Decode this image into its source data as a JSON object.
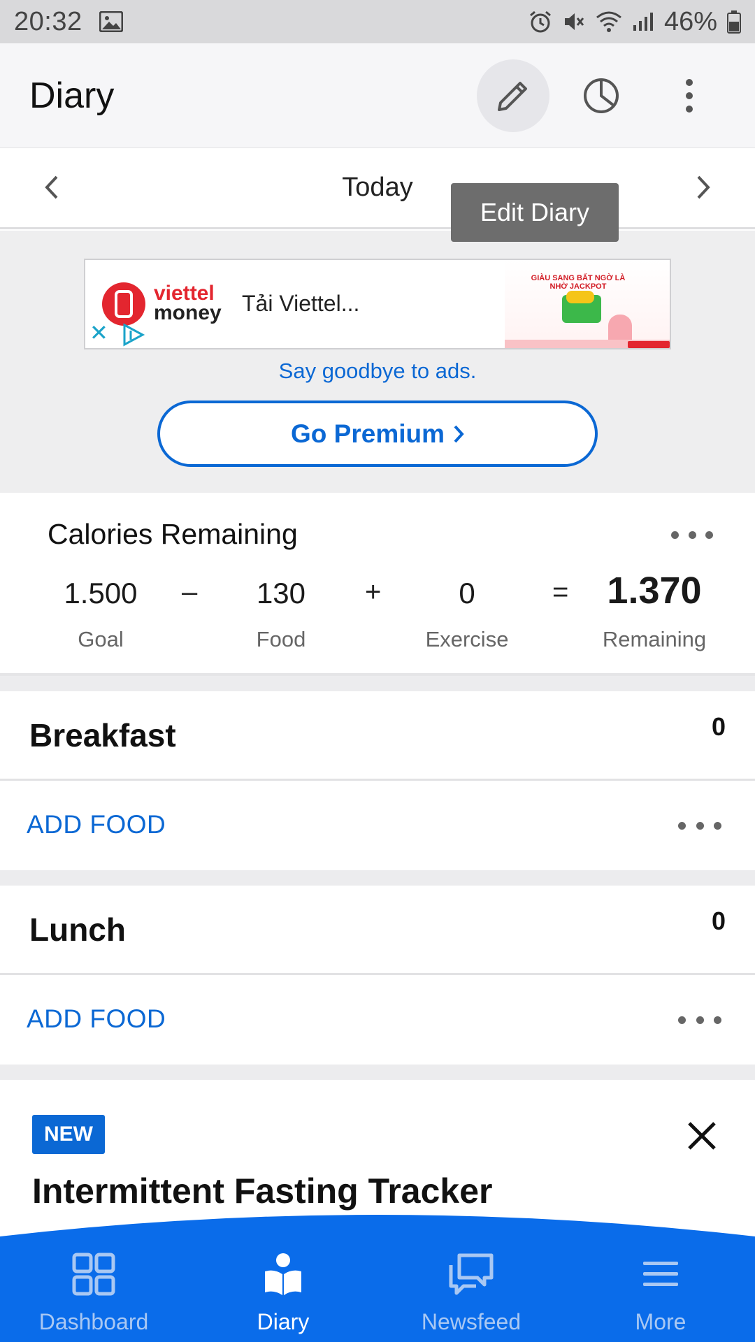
{
  "status_bar": {
    "time": "20:32",
    "battery": "46%"
  },
  "app_bar": {
    "title": "Diary",
    "icons": [
      "pencil-icon",
      "pie-chart-icon",
      "overflow-menu-icon"
    ]
  },
  "tooltip": {
    "text": "Edit Diary"
  },
  "date_nav": {
    "label": "Today"
  },
  "ad": {
    "brand_line1": "viettel",
    "brand_line2": "money",
    "text": "Tải Viettel...",
    "image_caption": "GIÀU SANG BẤT NGỜ LÀ NHỜ JACKPOT",
    "goodbye_text": "Say goodbye to ads.",
    "premium_label": "Go Premium",
    "colors": {
      "brand_red": "#e3262f"
    }
  },
  "calories": {
    "title": "Calories Remaining",
    "goal": {
      "value": "1.500",
      "label": "Goal"
    },
    "op_minus": "–",
    "food": {
      "value": "130",
      "label": "Food"
    },
    "op_plus": "+",
    "exercise": {
      "value": "0",
      "label": "Exercise"
    },
    "op_equals": "=",
    "remaining": {
      "value": "1.370",
      "label": "Remaining"
    }
  },
  "meals": [
    {
      "title": "Breakfast",
      "calories": "0",
      "add_label": "ADD FOOD"
    },
    {
      "title": "Lunch",
      "calories": "0",
      "add_label": "ADD FOOD"
    }
  ],
  "promo": {
    "badge": "NEW",
    "title": "Intermittent Fasting Tracker"
  },
  "bottom_nav": {
    "items": [
      {
        "label": "Dashboard",
        "icon": "dashboard-icon",
        "active": false
      },
      {
        "label": "Diary",
        "icon": "diary-book-icon",
        "active": true
      },
      {
        "label": "Newsfeed",
        "icon": "newsfeed-chat-icon",
        "active": false
      },
      {
        "label": "More",
        "icon": "hamburger-menu-icon",
        "active": false
      }
    ]
  },
  "theme": {
    "accent": "#0b68d4",
    "nav_bg": "#0a6cea",
    "inactive": "#a9c8f3"
  }
}
